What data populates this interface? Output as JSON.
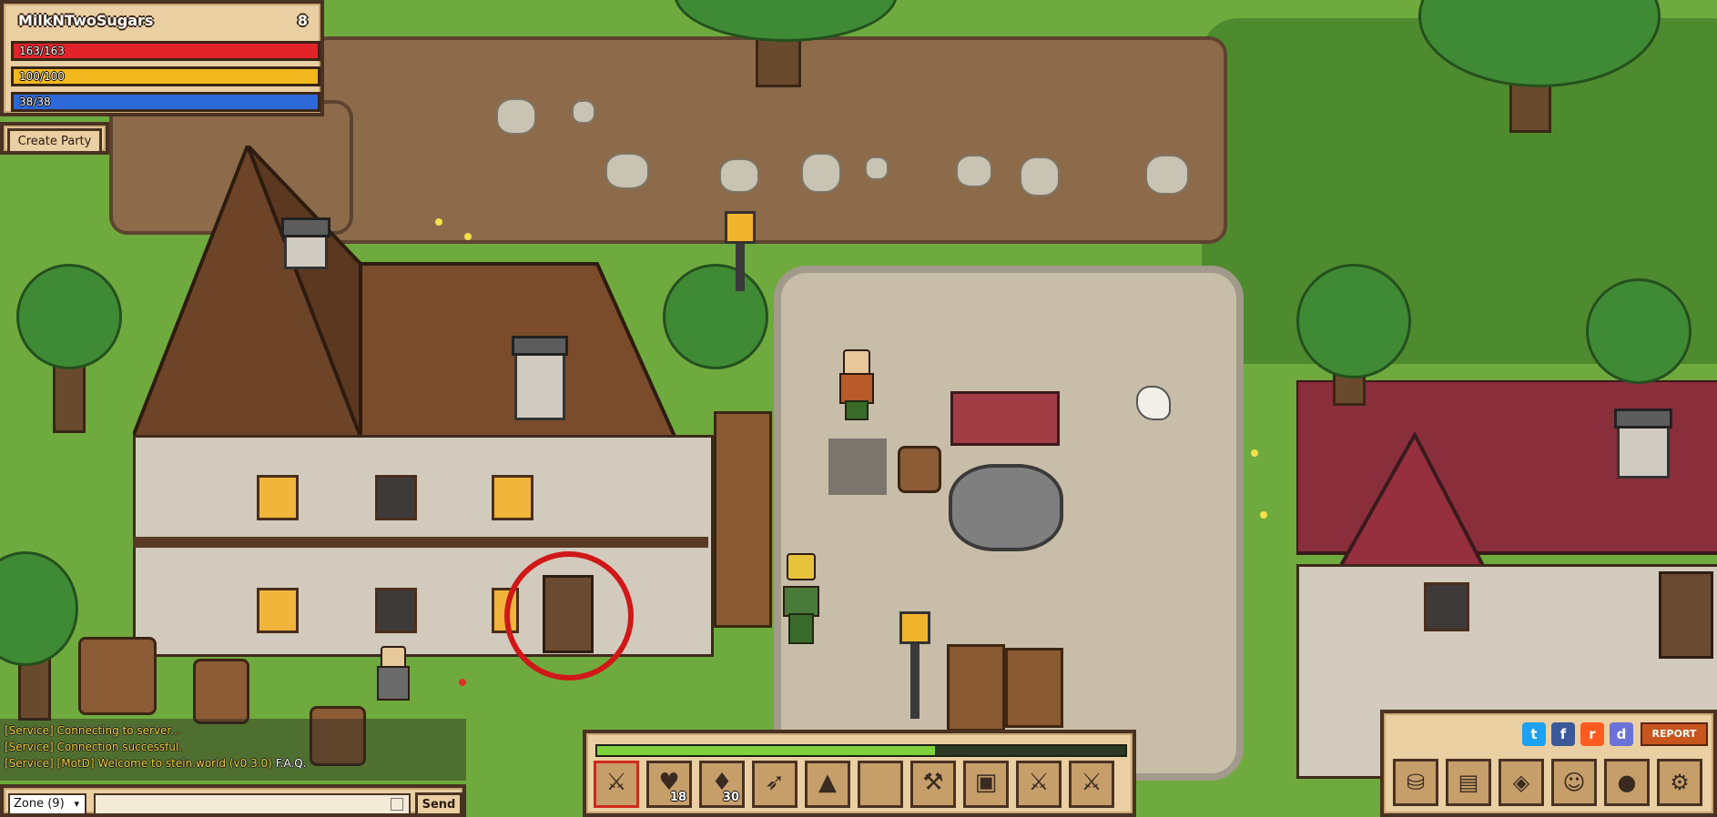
{
  "player": {
    "name": "MilkNTwoSugars",
    "level": "8",
    "hp": "163/163",
    "mana": "100/100",
    "experience": "38/38"
  },
  "party": {
    "create_label": "Create Party"
  },
  "chat": {
    "lines": [
      {
        "text": "[Service] Connecting to server..."
      },
      {
        "text": "[Service] Connection successful."
      },
      {
        "text": "[Service] [MotD] Welcome to stein.world (v0.3.0)",
        "link": "F.A.Q."
      }
    ],
    "zone_selected": "Zone (9)",
    "input_value": "",
    "send_label": "Send"
  },
  "hotbar": {
    "exp_progress": 0.64,
    "slots": [
      {
        "icon": "sword-icon",
        "glyph": "⚔",
        "count": "",
        "active": true
      },
      {
        "icon": "health-potion-icon",
        "glyph": "♥",
        "count": "18"
      },
      {
        "icon": "mana-potion-icon",
        "glyph": "♦",
        "count": "30"
      },
      {
        "icon": "bow-icon",
        "glyph": "➶",
        "count": ""
      },
      {
        "icon": "hat-icon",
        "glyph": "▲",
        "count": ""
      },
      {
        "icon": "empty-slot",
        "glyph": "",
        "count": ""
      },
      {
        "icon": "axe-icon",
        "glyph": "⚒",
        "count": ""
      },
      {
        "icon": "map-scroll-icon",
        "glyph": "▣",
        "count": ""
      },
      {
        "icon": "sword-icon",
        "glyph": "⚔",
        "count": ""
      },
      {
        "icon": "sword-icon",
        "glyph": "⚔",
        "count": ""
      }
    ]
  },
  "social": {
    "twitter": "t",
    "facebook": "f",
    "reddit": "r",
    "discord": "d",
    "report_label": "REPORT"
  },
  "menu": {
    "items": [
      {
        "icon": "inventory-bag-icon",
        "glyph": "⛁"
      },
      {
        "icon": "quest-book-icon",
        "glyph": "▤"
      },
      {
        "icon": "world-map-icon",
        "glyph": "◈"
      },
      {
        "icon": "character-icon",
        "glyph": "☺"
      },
      {
        "icon": "gold-coins-icon",
        "glyph": "●"
      },
      {
        "icon": "settings-gear-icon",
        "glyph": "⚙"
      }
    ]
  },
  "colors": {
    "hp": "#e3232a",
    "mana": "#f3b81e",
    "experience": "#2c68d8",
    "chat_text": "#f2d23a",
    "panel": "#e9cfa2"
  }
}
